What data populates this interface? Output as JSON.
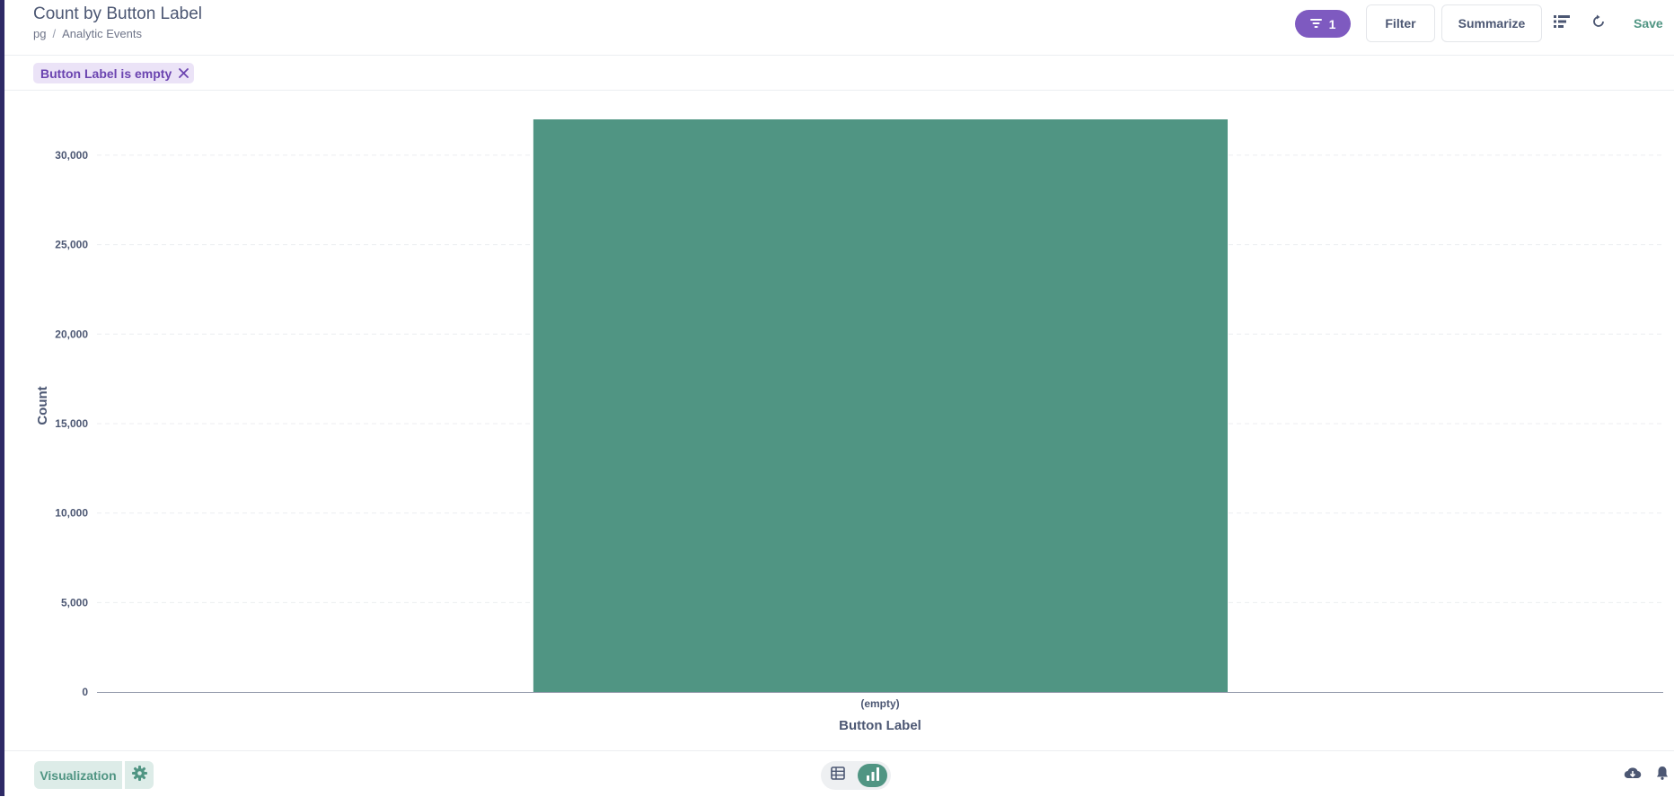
{
  "header": {
    "title": "Count by Button Label",
    "breadcrumb": {
      "database": "pg",
      "separator": "/",
      "table": "Analytic Events"
    },
    "filter_count": "1",
    "filter_label": "Filter",
    "summarize_label": "Summarize",
    "save_label": "Save"
  },
  "filters": [
    {
      "label": "Button Label is empty"
    }
  ],
  "colors": {
    "bar": "#509583",
    "accent": "#7e5ac0",
    "brand": "#509583"
  },
  "icons": {
    "filter": "filter-icon",
    "notebook": "notebook-icon",
    "refresh": "refresh-icon",
    "close": "close-icon",
    "gear": "gear-icon",
    "table": "table-icon",
    "bar_chart": "bar-chart-icon",
    "download": "download-icon",
    "bell": "bell-icon"
  },
  "chart_data": {
    "type": "bar",
    "categories": [
      "(empty)"
    ],
    "values": [
      32000
    ],
    "xlabel": "Button Label",
    "ylabel": "Count",
    "ylim": [
      0,
      32000
    ],
    "yticks": [
      0,
      5000,
      10000,
      15000,
      20000,
      25000,
      30000
    ],
    "ytick_labels": [
      "0",
      "5,000",
      "10,000",
      "15,000",
      "20,000",
      "25,000",
      "30,000"
    ],
    "grid": true
  },
  "footer": {
    "visualization_label": "Visualization"
  }
}
